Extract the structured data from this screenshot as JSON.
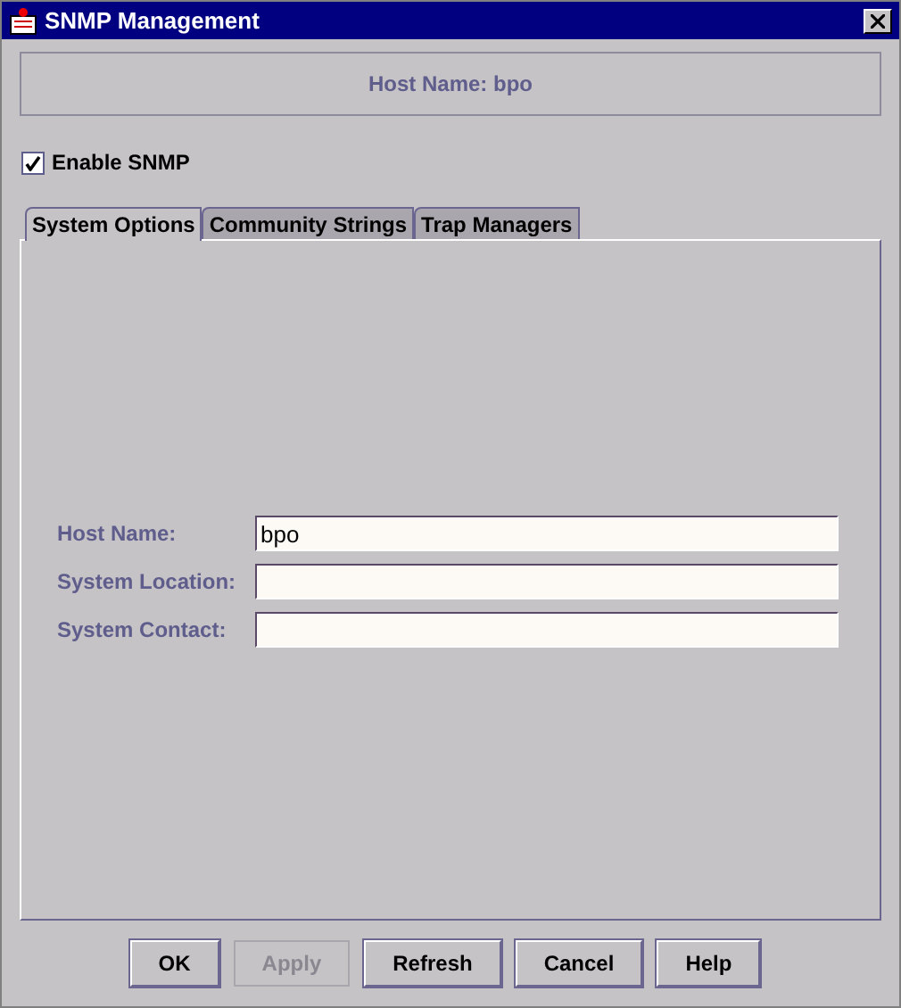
{
  "window": {
    "title": "SNMP Management"
  },
  "header": {
    "text": "Host Name: bpo"
  },
  "enable_snmp": {
    "label": "Enable SNMP",
    "checked": true
  },
  "tabs": [
    {
      "label": "System Options",
      "selected": true
    },
    {
      "label": "Community Strings",
      "selected": false
    },
    {
      "label": "Trap Managers",
      "selected": false
    }
  ],
  "fields": [
    {
      "label": "Host Name:",
      "value": "bpo"
    },
    {
      "label": "System Location:"
    },
    {
      "label": "System Contact:"
    }
  ],
  "buttons": [
    {
      "label": "OK",
      "disabled": false
    },
    {
      "label": "Apply",
      "disabled": true
    },
    {
      "label": "Refresh",
      "disabled": false
    },
    {
      "label": "Cancel",
      "disabled": false
    },
    {
      "label": "Help",
      "disabled": false
    }
  ]
}
